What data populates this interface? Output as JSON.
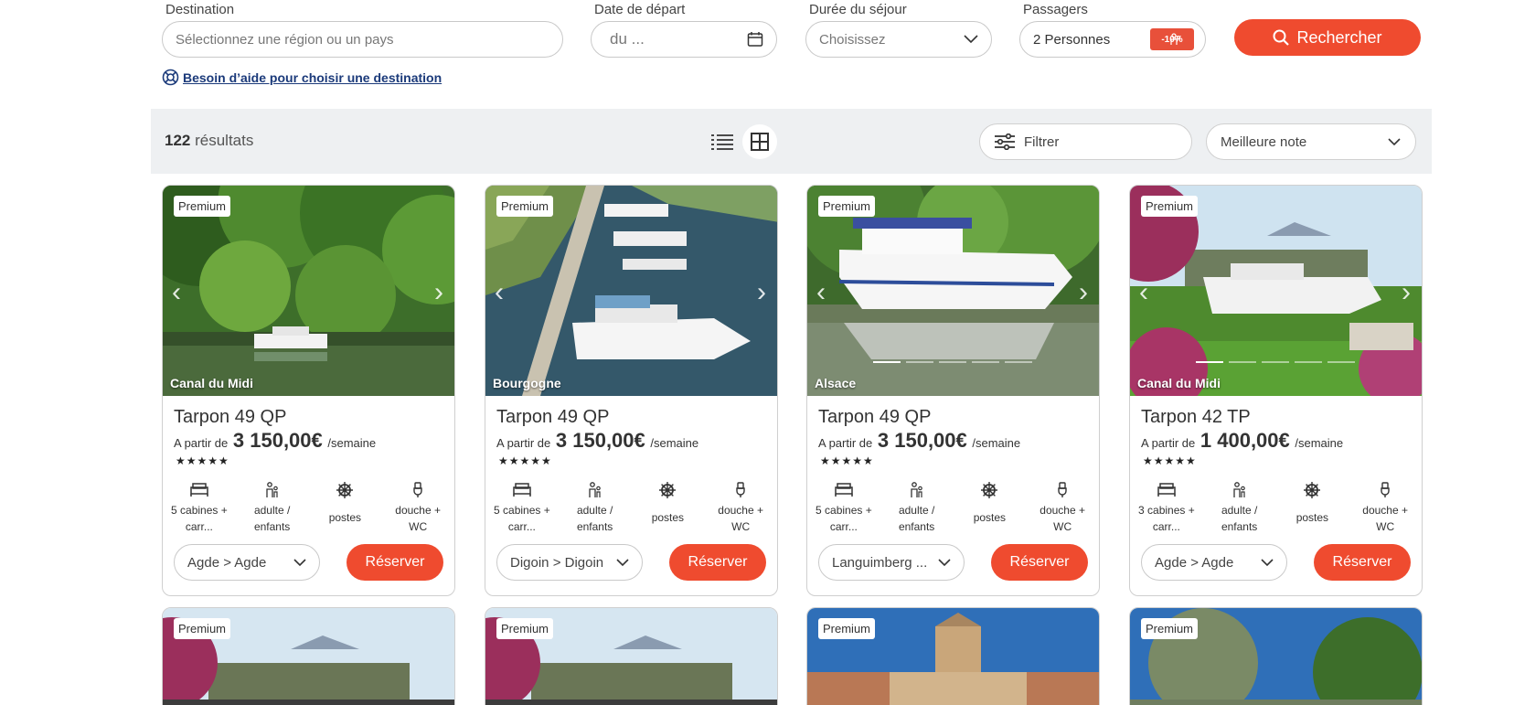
{
  "search": {
    "destination": {
      "label": "Destination",
      "placeholder": "Sélectionnez une région ou un pays"
    },
    "departure": {
      "label": "Date de départ",
      "placeholder": "du ..."
    },
    "duration": {
      "label": "Durée du séjour",
      "placeholder": "Choisissez"
    },
    "passengers": {
      "label": "Passagers",
      "value": "2 Personnes",
      "promo": "-10%"
    },
    "search_button": "Rechercher",
    "help_link": "Besoin d’aide pour choisir une destination"
  },
  "results": {
    "count": "122",
    "count_label": "résultats",
    "filter_label": "Filtrer",
    "sort_value": "Meilleure note"
  },
  "cards": [
    {
      "badge": "Premium",
      "region": "Canal du Midi",
      "name": "Tarpon 49 QP",
      "price_prefix": "A partir de",
      "price": "3 150,00€",
      "price_suffix": "/semaine",
      "stars": "★★★★★",
      "f1": "5 cabines + carr...",
      "f2": "adulte / enfants",
      "f3": "postes",
      "f4": "douche + WC",
      "route": "Agde > Agde",
      "reserve": "Réserver"
    },
    {
      "badge": "Premium",
      "region": "Bourgogne",
      "name": "Tarpon 49 QP",
      "price_prefix": "A partir de",
      "price": "3 150,00€",
      "price_suffix": "/semaine",
      "stars": "★★★★★",
      "f1": "5 cabines + carr...",
      "f2": "adulte / enfants",
      "f3": "postes",
      "f4": "douche + WC",
      "route": "Digoin > Digoin",
      "reserve": "Réserver"
    },
    {
      "badge": "Premium",
      "region": "Alsace",
      "name": "Tarpon 49 QP",
      "price_prefix": "A partir de",
      "price": "3 150,00€",
      "price_suffix": "/semaine",
      "stars": "★★★★★",
      "f1": "5 cabines + carr...",
      "f2": "adulte / enfants",
      "f3": "postes",
      "f4": "douche + WC",
      "route": "Languimberg ...",
      "reserve": "Réserver"
    },
    {
      "badge": "Premium",
      "region": "Canal du Midi",
      "name": "Tarpon 42 TP",
      "price_prefix": "A partir de",
      "price": "1 400,00€",
      "price_suffix": "/semaine",
      "stars": "★★★★★",
      "f1": "3 cabines + carr...",
      "f2": "adulte / enfants",
      "f3": "postes",
      "f4": "douche + WC",
      "route": "Agde > Agde",
      "reserve": "Réserver"
    }
  ],
  "bottom_cards": [
    {
      "badge": "Premium"
    },
    {
      "badge": "Premium"
    },
    {
      "badge": "Premium"
    },
    {
      "badge": "Premium"
    }
  ],
  "colors": {
    "accent": "#ef4b2f",
    "link": "#1b3a7a"
  }
}
